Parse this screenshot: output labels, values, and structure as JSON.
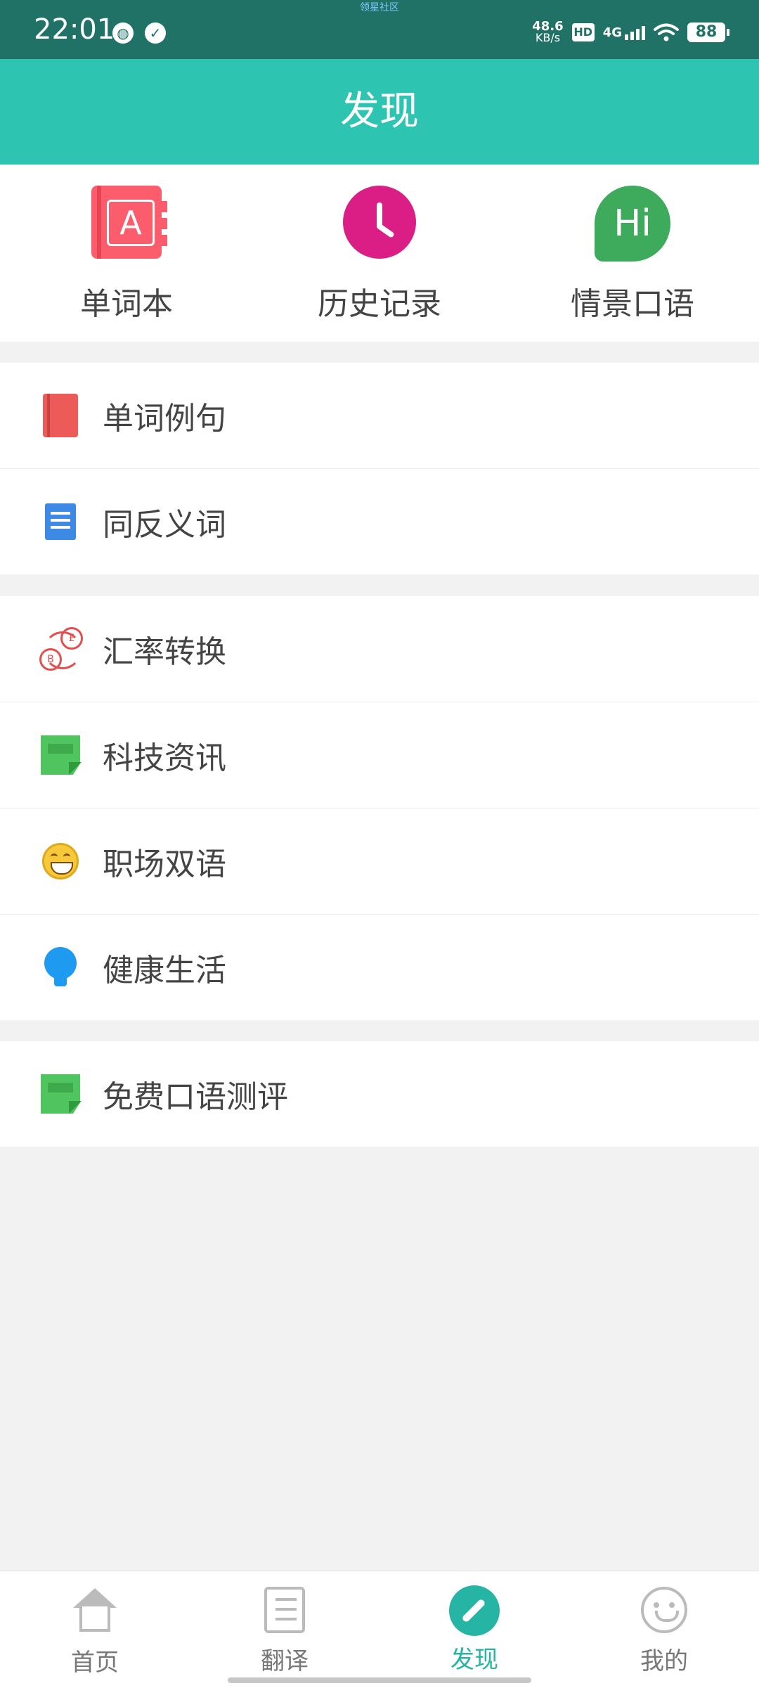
{
  "status_bar": {
    "time": "22:01",
    "speed_value": "48.6",
    "speed_unit": "KB/s",
    "hd": "HD",
    "network": "4G",
    "battery": "88",
    "community_tag": "领星社区"
  },
  "header": {
    "title": "发现"
  },
  "quick_actions": [
    {
      "label": "单词本",
      "icon": "notebook-icon",
      "icon_letter": "A"
    },
    {
      "label": "历史记录",
      "icon": "clock-icon"
    },
    {
      "label": "情景口语",
      "icon": "hi-chat-icon",
      "icon_text": "Hi"
    }
  ],
  "groups": [
    {
      "items": [
        {
          "label": "单词例句",
          "icon": "book-icon"
        },
        {
          "label": "同反义词",
          "icon": "document-icon"
        }
      ]
    },
    {
      "items": [
        {
          "label": "汇率转换",
          "icon": "currency-exchange-icon",
          "coin_top": "£",
          "coin_bottom": "B"
        },
        {
          "label": "科技资讯",
          "icon": "note-icon"
        },
        {
          "label": "职场双语",
          "icon": "grinning-face-icon"
        },
        {
          "label": "健康生活",
          "icon": "light-bulb-icon"
        }
      ]
    },
    {
      "items": [
        {
          "label": "免费口语测评",
          "icon": "note-icon"
        }
      ]
    }
  ],
  "bottom_nav": [
    {
      "label": "首页",
      "icon": "home-icon",
      "active": false
    },
    {
      "label": "翻译",
      "icon": "notebook-outline-icon",
      "active": false
    },
    {
      "label": "发现",
      "icon": "compass-icon",
      "active": true
    },
    {
      "label": "我的",
      "icon": "smile-icon",
      "active": false
    }
  ],
  "colors": {
    "status_bar": "#1f7265",
    "header": "#2ec4b2",
    "active_tab": "#26b5a4",
    "background": "#f2f2f2"
  }
}
